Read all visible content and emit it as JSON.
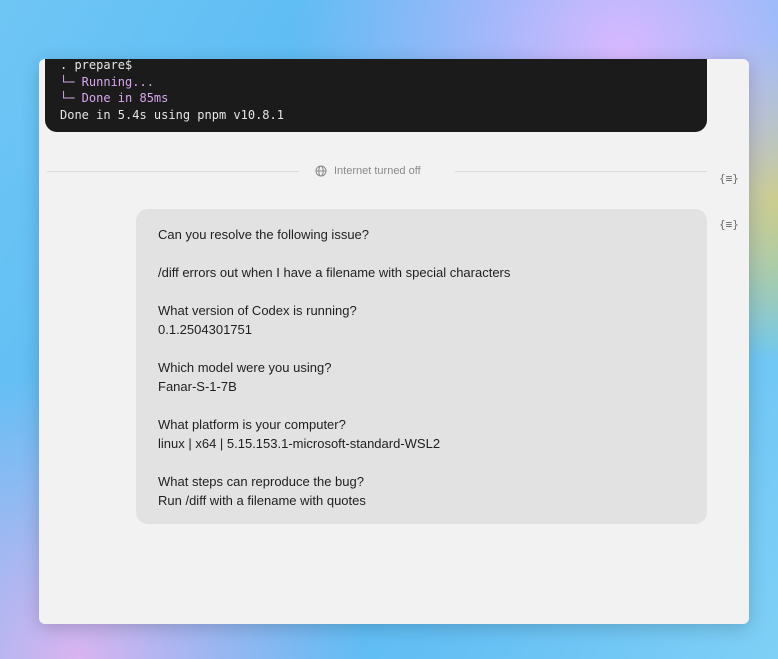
{
  "terminal": {
    "lines": [
      ". prepare$",
      "└─ Running...",
      "└─ Done in 85ms",
      "Done in 5.4s using pnpm v10.8.1"
    ]
  },
  "divider": {
    "label": "Internet turned off",
    "icon": "globe-icon"
  },
  "json_toggle_label": "{≡}",
  "message": {
    "line_1": "Can you resolve the following issue?",
    "line_2": "/diff errors out when I have a filename with special characters",
    "q_version": "What version of Codex is running?",
    "a_version": "0.1.2504301751",
    "q_model": "Which model were you using?",
    "a_model": "Fanar-S-1-7B",
    "q_platform": "What platform is your computer?",
    "a_platform": "linux | x64 | 5.15.153.1-microsoft-standard-WSL2",
    "q_steps": "What steps can reproduce the bug?",
    "a_steps": "Run /diff with a filename with quotes"
  },
  "colors": {
    "terminal_bg": "#1b1b1b",
    "terminal_accent": "#d8a6ee",
    "bubble_bg": "#e2e2e2",
    "window_bg": "#f2f2f2"
  }
}
